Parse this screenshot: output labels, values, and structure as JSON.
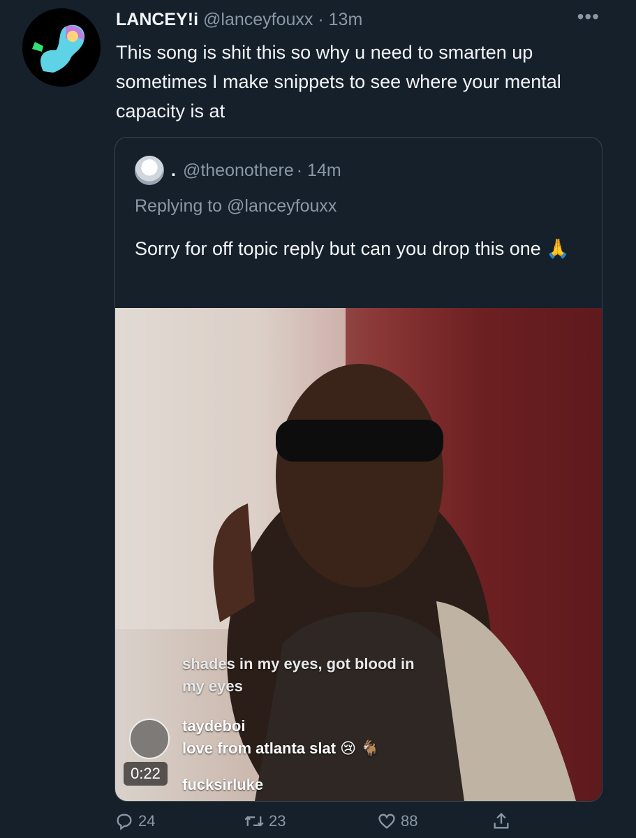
{
  "tweet": {
    "author_name": "LANCEY!i",
    "author_handle": "@lanceyfouxx",
    "time": "· 13m",
    "text": "This song is shit this so why u need to smarten up sometimes I make snippets to see where your mental capacity is at"
  },
  "quoted_tweet": {
    "author_name": ".",
    "author_handle": "@theonothere",
    "time": "· 14m",
    "replying_prefix": "Replying to",
    "replying_handle": "@lanceyfouxx",
    "text": "Sorry for off topic reply but can you drop this one 🙏"
  },
  "video": {
    "caption_line1": "shades in my eyes, got blood in",
    "caption_line2": "my eyes",
    "comments": [
      {
        "user": "taydeboi",
        "text": "love from atlanta slat 😢 🐐"
      },
      {
        "user": "fucksirluke",
        "text": ""
      }
    ],
    "duration": "0:22"
  },
  "actions": {
    "reply_count": "24",
    "retweet_count": "23",
    "like_count": "88"
  },
  "icons": [
    "more-icon",
    "reply-icon",
    "retweet-icon",
    "like-icon",
    "share-icon"
  ]
}
